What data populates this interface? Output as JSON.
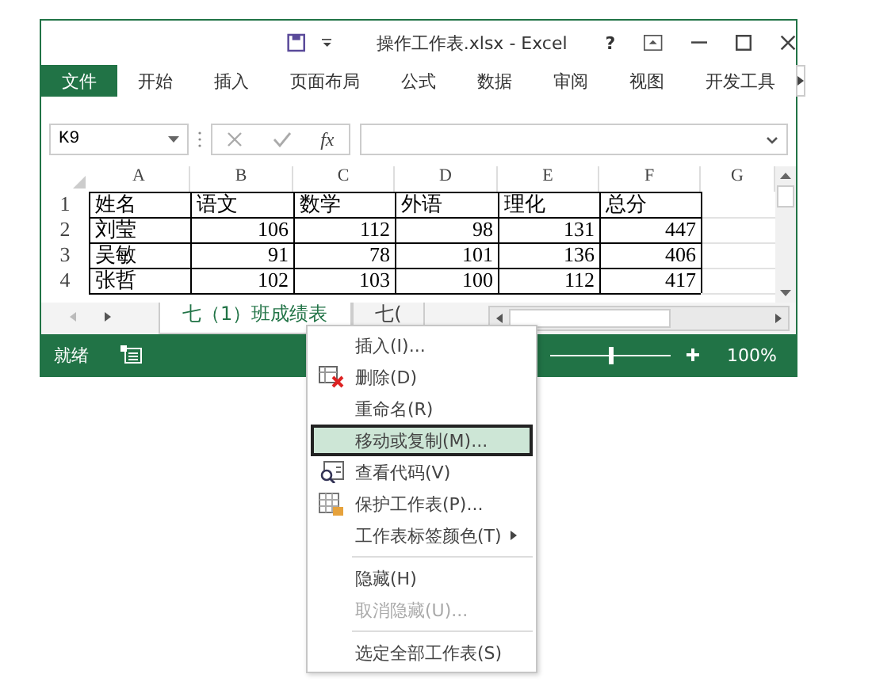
{
  "window": {
    "title": "操作工作表.xlsx - Excel",
    "help": "?"
  },
  "ribbon_tabs": [
    {
      "label": "文件",
      "selected": true
    },
    {
      "label": "开始",
      "selected": false
    },
    {
      "label": "插入",
      "selected": false
    },
    {
      "label": "页面布局",
      "selected": false
    },
    {
      "label": "公式",
      "selected": false
    },
    {
      "label": "数据",
      "selected": false
    },
    {
      "label": "审阅",
      "selected": false
    },
    {
      "label": "视图",
      "selected": false
    },
    {
      "label": "开发工具",
      "selected": false
    }
  ],
  "formula_bar": {
    "name_box": "K9",
    "function_label": "fx"
  },
  "sheet": {
    "columns": [
      "A",
      "B",
      "C",
      "D",
      "E",
      "F",
      "G"
    ],
    "rows": [
      {
        "header": "1",
        "cells": [
          "姓名",
          "语文",
          "数学",
          "外语",
          "理化",
          "总分"
        ]
      },
      {
        "header": "2",
        "cells": [
          "刘莹",
          "106",
          "112",
          "98",
          "131",
          "447"
        ]
      },
      {
        "header": "3",
        "cells": [
          "吴敏",
          "91",
          "78",
          "101",
          "136",
          "406"
        ]
      },
      {
        "header": "4",
        "cells": [
          "张哲",
          "102",
          "103",
          "100",
          "112",
          "417"
        ]
      }
    ]
  },
  "sheet_tabs": [
    {
      "label": "七（1）班成绩表",
      "selected": true
    },
    {
      "label": "七(",
      "selected": false
    }
  ],
  "status_bar": {
    "status": "就绪",
    "zoom": {
      "level": 0.5
    },
    "zoom_label": "100%"
  },
  "context_menu": [
    {
      "kind": "plain",
      "label": "插入(I)...",
      "hovered": false,
      "disabled": false
    },
    {
      "kind": "delete",
      "label": "删除(D)",
      "hovered": false,
      "disabled": false
    },
    {
      "kind": "plain",
      "label": "重命名(R)",
      "hovered": false,
      "disabled": false
    },
    {
      "kind": "plain",
      "label": "移动或复制(M)...",
      "hovered": true,
      "disabled": false
    },
    {
      "kind": "code",
      "label": "查看代码(V)",
      "hovered": false,
      "disabled": false
    },
    {
      "kind": "protect",
      "label": "保护工作表(P)...",
      "hovered": false,
      "disabled": false
    },
    {
      "kind": "submenu",
      "label": "工作表标签颜色(T)",
      "hovered": false,
      "disabled": false
    },
    {
      "kind": "separator"
    },
    {
      "kind": "plain",
      "label": "隐藏(H)",
      "hovered": false,
      "disabled": false
    },
    {
      "kind": "plain",
      "label": "取消隐藏(U)...",
      "hovered": false,
      "disabled": true
    },
    {
      "kind": "separator"
    },
    {
      "kind": "plain",
      "label": "选定全部工作表(S)",
      "hovered": false,
      "disabled": false
    }
  ]
}
